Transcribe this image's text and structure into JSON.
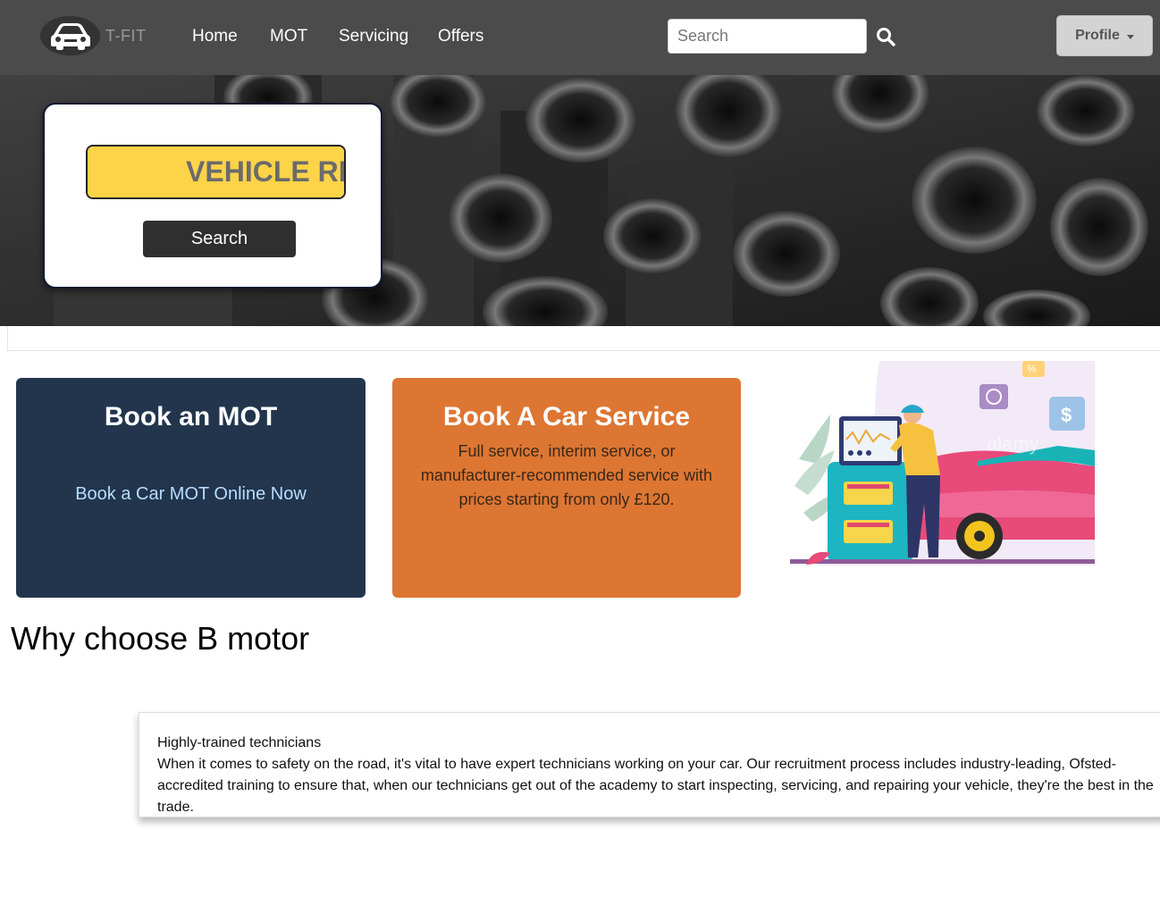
{
  "navbar": {
    "brand": "T-FIT",
    "links": [
      "Home",
      "MOT",
      "Servicing",
      "Offers"
    ],
    "search_placeholder": "Search",
    "profile_label": "Profile"
  },
  "hero": {
    "plate_placeholder": "VEHICLE REG",
    "search_label": "Search"
  },
  "cards": {
    "mot": {
      "title": "Book an MOT",
      "link": "Book a Car MOT Online Now"
    },
    "service": {
      "title": "Book A Car Service",
      "description": "Full service, interim service, or manufacturer-recommended service with prices starting from only £120."
    }
  },
  "illustration": {
    "watermark": "alamy"
  },
  "why": {
    "title": "Why choose B motor",
    "feature_title": "Highly-trained technicians",
    "feature_text": "When it comes to safety on the road, it's vital to have expert technicians working on your car. Our recruitment process includes industry-leading, Ofsted-accredited training to ensure that, when our technicians get out of the academy to start inspecting, servicing, and repairing your vehicle, they're the best in the trade."
  },
  "colors": {
    "navbar": "#4b4b4b",
    "mot_card": "#22354d",
    "service_card": "#dd7633",
    "plate_yellow": "#fdd348",
    "plate_band": "#1a1a6e"
  },
  "icons": [
    "car-logo-icon",
    "search-icon",
    "caret-down-icon"
  ]
}
